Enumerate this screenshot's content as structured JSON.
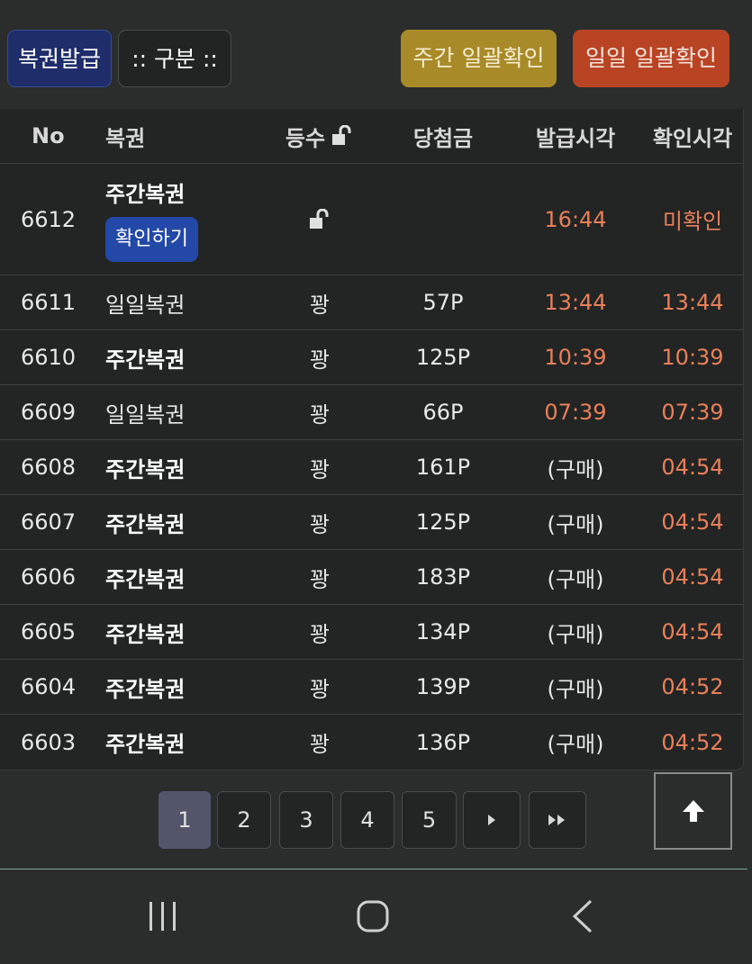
{
  "toolbar": {
    "issue_label": "복권발급",
    "filter_label": ":: 구분 ::",
    "weekly_check_label": "주간 일괄확인",
    "daily_check_label": "일일 일괄확인"
  },
  "table": {
    "headers": {
      "no": "No",
      "type": "복권",
      "grade": "등수",
      "prize": "당첨금",
      "issue_time": "발급시각",
      "check_time": "확인시각"
    },
    "rows": [
      {
        "no": "6612",
        "type": "주간복권",
        "action": "확인하기",
        "grade": "",
        "prize": "",
        "issue_time": "16:44",
        "check_time": "미확인"
      },
      {
        "no": "6611",
        "type": "일일복권",
        "grade": "꽝",
        "prize": "57P",
        "issue_time": "13:44",
        "check_time": "13:44"
      },
      {
        "no": "6610",
        "type": "주간복권",
        "grade": "꽝",
        "prize": "125P",
        "issue_time": "10:39",
        "check_time": "10:39"
      },
      {
        "no": "6609",
        "type": "일일복권",
        "grade": "꽝",
        "prize": "66P",
        "issue_time": "07:39",
        "check_time": "07:39"
      },
      {
        "no": "6608",
        "type": "주간복권",
        "grade": "꽝",
        "prize": "161P",
        "issue_time": "(구매)",
        "check_time": "04:54"
      },
      {
        "no": "6607",
        "type": "주간복권",
        "grade": "꽝",
        "prize": "125P",
        "issue_time": "(구매)",
        "check_time": "04:54"
      },
      {
        "no": "6606",
        "type": "주간복권",
        "grade": "꽝",
        "prize": "183P",
        "issue_time": "(구매)",
        "check_time": "04:54"
      },
      {
        "no": "6605",
        "type": "주간복권",
        "grade": "꽝",
        "prize": "134P",
        "issue_time": "(구매)",
        "check_time": "04:54"
      },
      {
        "no": "6604",
        "type": "주간복권",
        "grade": "꽝",
        "prize": "139P",
        "issue_time": "(구매)",
        "check_time": "04:52"
      },
      {
        "no": "6603",
        "type": "주간복권",
        "grade": "꽝",
        "prize": "136P",
        "issue_time": "(구매)",
        "check_time": "04:52"
      }
    ]
  },
  "pagination": {
    "pages": [
      "1",
      "2",
      "3",
      "4",
      "5"
    ],
    "current": "1",
    "next_icon": "chevron-right-icon",
    "last_icon": "double-chevron-right-icon"
  },
  "scroll_top_icon": "arrow-up-icon",
  "system_nav": {
    "recent_icon": "recent-apps-icon",
    "home_icon": "home-icon",
    "back_icon": "back-icon"
  },
  "colors": {
    "issue_button": "#1f2d6b",
    "weekly_button": "#a88a28",
    "daily_button": "#b84424",
    "confirm_button": "#2348a8",
    "time_accent": "#e8805a",
    "active_page": "#53566a"
  }
}
